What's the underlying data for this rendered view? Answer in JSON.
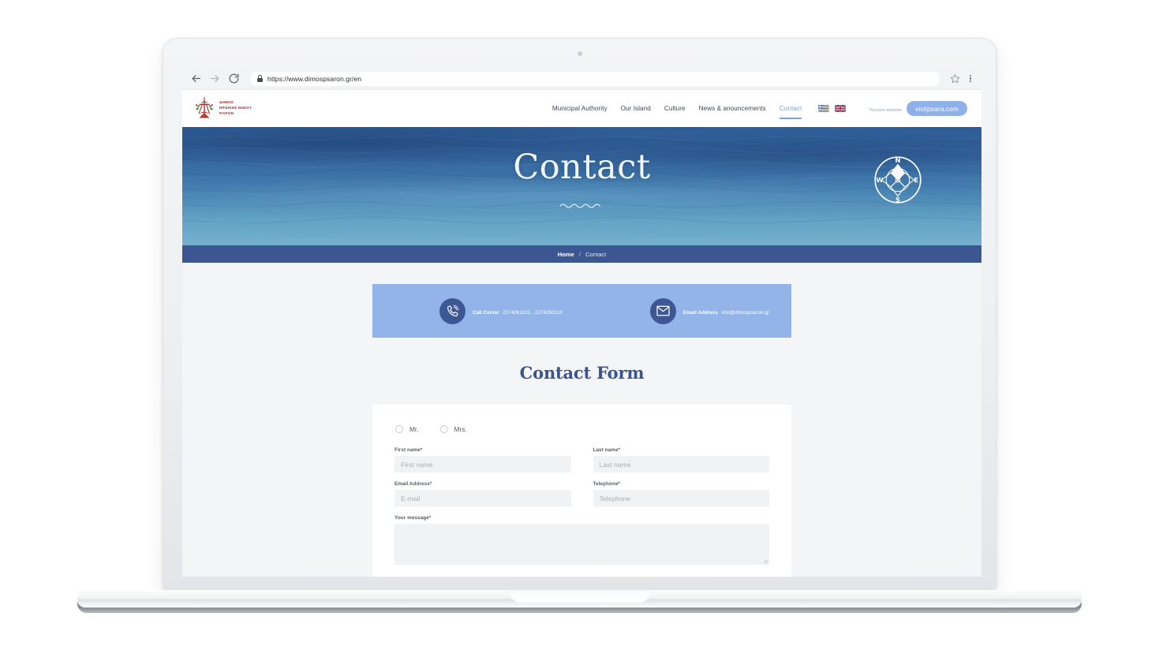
{
  "browser": {
    "back_icon": "arrow-left-icon",
    "forward_icon": "arrow-right-icon",
    "reload_icon": "reload-icon",
    "lock_icon": "lock-icon",
    "url": "https://www.dimospsaron.gr/en",
    "bookmark_icon": "star-icon",
    "menu_icon": "kebab-menu-icon"
  },
  "header": {
    "logo_line1": "ΔΗΜΟΣ",
    "logo_line2": "ΗΡΩΙΚΗΣ ΝΗΣΟΥ",
    "logo_line3": "ΨΑΡΩΝ",
    "nav": [
      {
        "label": "Municipal Authority",
        "active": false
      },
      {
        "label": "Our Island",
        "active": false
      },
      {
        "label": "Culture",
        "active": false
      },
      {
        "label": "News & anouncements",
        "active": false
      },
      {
        "label": "Contact",
        "active": true
      }
    ],
    "flag_greek": "greek-flag-icon",
    "flag_uk": "uk-flag-icon",
    "tourism_label": "Tourism website:",
    "tourism_button": "visitpsara.com",
    "accent_color": "#8fb0e8",
    "active_nav_color": "#7aa5e0"
  },
  "hero": {
    "title": "Contact",
    "squiggle": "wave-divider",
    "compass": {
      "north": "N",
      "east": "E",
      "south": "S",
      "west": "W"
    }
  },
  "breadcrumb": {
    "home": "Home",
    "separator": "/",
    "current": "Contact",
    "bar_color": "#3c5691"
  },
  "info_band": {
    "background": "#93b4e8",
    "items": [
      {
        "icon": "phone-icon",
        "label": "Call Center",
        "value": "2274061101 - 2274350110"
      },
      {
        "icon": "envelope-icon",
        "label": "Email Address",
        "value": "info@dimospsaron.gr"
      }
    ]
  },
  "form": {
    "title": "Contact Form",
    "title_color": "#3b5490",
    "salutation": [
      {
        "label": "Mr.",
        "selected": false
      },
      {
        "label": "Mrs.",
        "selected": false
      }
    ],
    "fields": {
      "first_name": {
        "label": "First name*",
        "placeholder": "First name",
        "value": ""
      },
      "last_name": {
        "label": "Last name*",
        "placeholder": "Last name",
        "value": ""
      },
      "email": {
        "label": "Email Address*",
        "placeholder": "E-mail",
        "value": ""
      },
      "telephone": {
        "label": "Telephone*",
        "placeholder": "Telephone",
        "value": ""
      },
      "message": {
        "label": "Your message*",
        "placeholder": "",
        "value": ""
      }
    }
  }
}
